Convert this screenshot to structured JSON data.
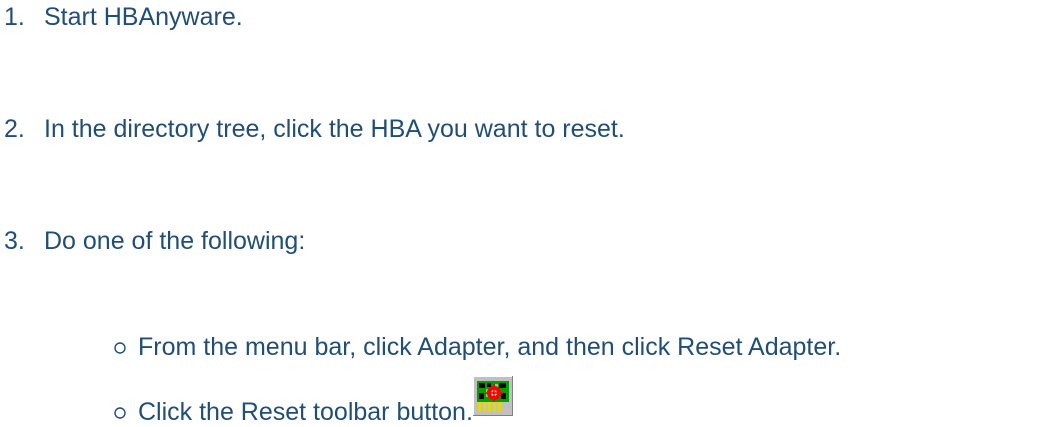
{
  "steps": [
    {
      "num": "1.",
      "text": "Start HBAnyware."
    },
    {
      "num": "2.",
      "text": "In the directory tree, click the HBA you want to reset."
    },
    {
      "num": "3.",
      "text": "Do one of the following:"
    }
  ],
  "options": [
    {
      "text": "From the menu bar, click Adapter, and then click Reset Adapter."
    },
    {
      "text": "Click the Reset toolbar button."
    }
  ],
  "icons": {
    "bullet": "hollow-circle-bullet-icon",
    "reset": "reset-adapter-toolbar-icon"
  },
  "colors": {
    "text": "#1f4e79"
  }
}
